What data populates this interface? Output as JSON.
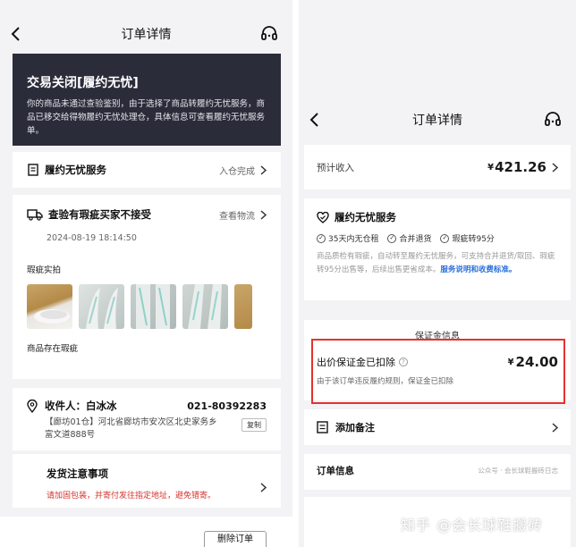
{
  "left": {
    "header": {
      "title": "订单详情"
    },
    "banner": {
      "title": "交易关闭[履约无忧]",
      "text": "你的商品未通过查验鉴别，由于选择了商品转履约无忧服务，商品已移交给得物履约无忧处理仓，具体信息可查看履约无忧服务单。"
    },
    "service": {
      "label": "履约无忧服务",
      "status": "入仓完成"
    },
    "inspection": {
      "title": "查验有瑕疵买家不接受",
      "action": "查看物流",
      "time": "2024-08-19 18:14:50",
      "photos_label": "瑕疵实拍",
      "storage_note": "商品存在瑕疵"
    },
    "address": {
      "receiver_label": "收件人：白冰冰",
      "phone": "021-80392283",
      "line": "【廊坊01仓】河北省廊坊市安次区北史家务乡富文道888号",
      "copy_label": "复制"
    },
    "shipping": {
      "title": "发货注意事项",
      "note": "请加固包装，并寄付发往指定地址，避免错寄。"
    },
    "bottom_button": "删除订单"
  },
  "right": {
    "header": {
      "title": "订单详情"
    },
    "income": {
      "label": "预计收入",
      "currency": "¥",
      "amount": "421.26"
    },
    "service": {
      "title": "履约无忧服务",
      "chips": [
        "35天内无仓租",
        "合并退货",
        "瑕疵转95分"
      ],
      "desc": "商品质检有瑕疵，自动转至履约无忧服务，可支持合并退货/取回、瑕疵转95分出售等，后续出售更省成本。",
      "link": "服务说明和收费标准。"
    },
    "deposit": {
      "section_title": "保证金信息",
      "label": "出价保证金已扣除",
      "currency": "¥",
      "amount": "24.00",
      "note": "由于该订单违反履约规则，保证金已扣除"
    },
    "remark": {
      "label": "添加备注"
    },
    "order_info": {
      "label": "订单信息",
      "account_watermark": "公众号 · 会长球鞋搬砖日志"
    }
  },
  "watermark": "知乎 @会长球鞋搬砖",
  "colors": {
    "banner_bg": "#2b2c3a",
    "highlight_red": "#e5322d",
    "link_blue": "#2a6fdb",
    "warning_red": "#d4322c"
  }
}
